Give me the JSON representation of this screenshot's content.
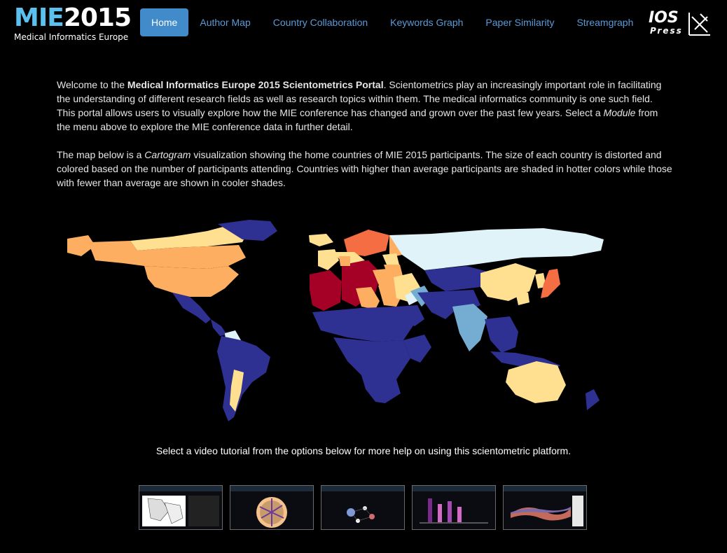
{
  "logo": {
    "main_prefix": "MIE",
    "main_year": "2015",
    "subtitle": "Medical Informatics Europe"
  },
  "nav": {
    "items": [
      {
        "label": "Home",
        "active": true
      },
      {
        "label": "Author Map",
        "active": false
      },
      {
        "label": "Country Collaboration",
        "active": false
      },
      {
        "label": "Keywords Graph",
        "active": false
      },
      {
        "label": "Paper Similarity",
        "active": false
      },
      {
        "label": "Streamgraph",
        "active": false
      }
    ]
  },
  "ios_logo": {
    "line1": "IOS",
    "line2": "Press"
  },
  "intro": {
    "p1_a": "Welcome to the ",
    "p1_bold": "Medical Informatics Europe 2015 Scientometrics Portal",
    "p1_b": ". Scientometrics play an increasingly important role in facilitating the understanding of different research fields as well as research topics within them. The medical informatics community is one such field. This portal allows users to visually explore how the MIE conference has changed and grown over the past few years. Select a ",
    "p1_italic": "Module",
    "p1_c": " from the menu above to explore the MIE conference data in further detail.",
    "p2_a": "The map below is a ",
    "p2_italic": "Cartogram",
    "p2_b": " visualization showing the home countries of MIE 2015 participants. The size of each country is distorted and colored based on the number of participants attending. Countries with higher than average participants are shaded in hotter colors while those with fewer than average are shown in cooler shades."
  },
  "map": {
    "colors": {
      "low": "#2e3192",
      "cool": "#e0f3f8",
      "mid_cool": "#74add1",
      "mid": "#fee090",
      "warm": "#fdae61",
      "hot": "#f46d43",
      "hottest": "#a50026"
    }
  },
  "tutorial": {
    "text": "Select a video tutorial from the options below for more help on using this scientometric platform."
  },
  "thumbnails": [
    {
      "name": "author-map-tutorial"
    },
    {
      "name": "country-collaboration-tutorial"
    },
    {
      "name": "keywords-graph-tutorial"
    },
    {
      "name": "paper-similarity-tutorial"
    },
    {
      "name": "streamgraph-tutorial"
    }
  ]
}
